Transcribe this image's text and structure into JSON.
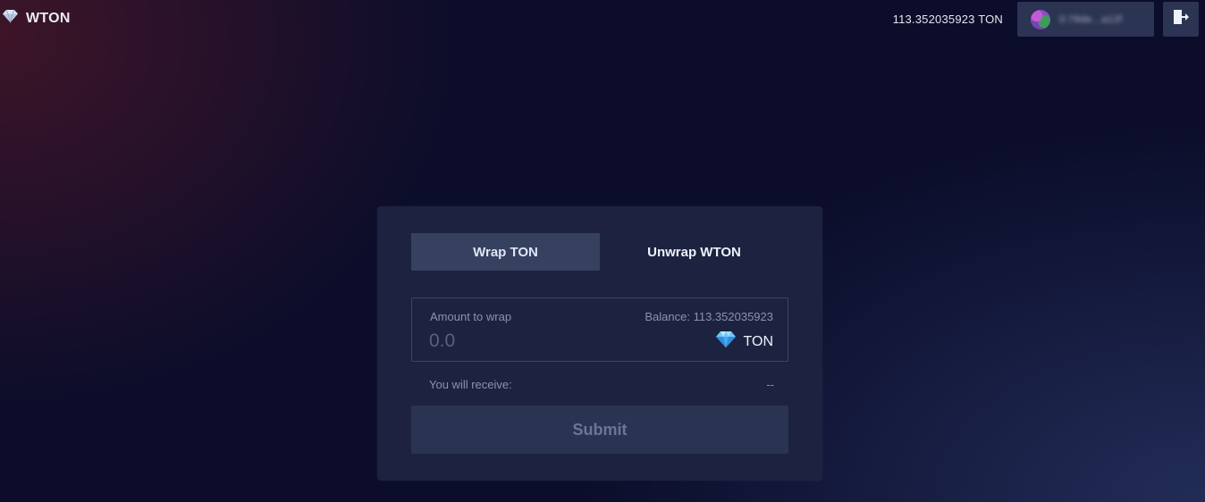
{
  "brand": {
    "title": "WTON",
    "icon": "diamond-icon"
  },
  "header": {
    "balance": "113.352035923 TON",
    "wallet_address": "0:78de...a12f",
    "logout_icon": "logout-icon"
  },
  "tabs": [
    {
      "label": "Wrap TON",
      "active": true
    },
    {
      "label": "Unwrap WTON",
      "active": false
    }
  ],
  "form": {
    "amount_label": "Amount to wrap",
    "balance_label": "Balance: 113.352035923",
    "amount_placeholder": "0.0",
    "token_label": "TON",
    "token_icon": "ton-diamond-icon",
    "receive_label": "You will receive:",
    "receive_value": "--",
    "submit_label": "Submit"
  },
  "colors": {
    "background": "#0b0d2a",
    "card": "#1c2240",
    "tab_active": "#36405f",
    "diamond": "#4fb6ff"
  }
}
